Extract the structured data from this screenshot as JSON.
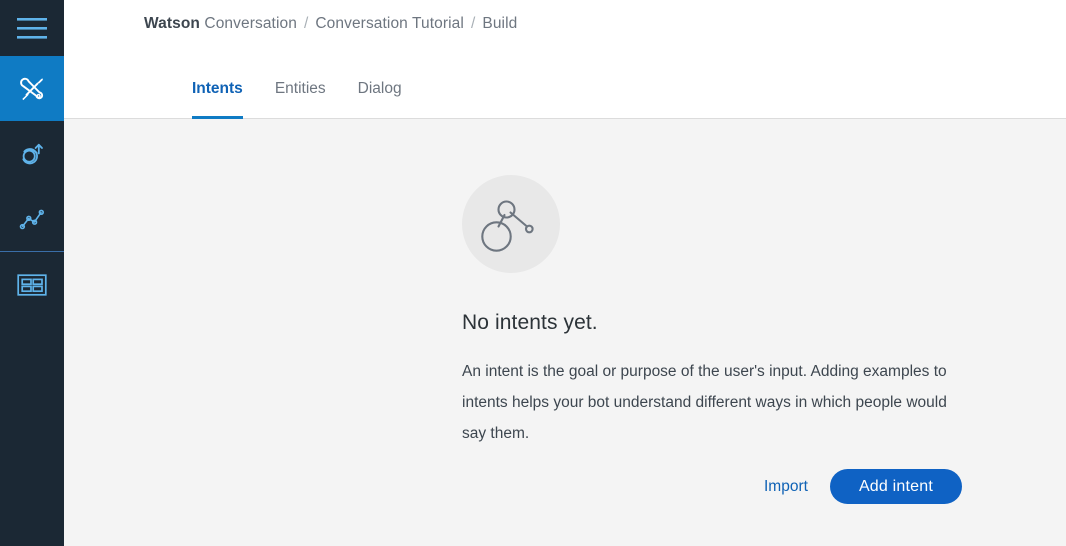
{
  "colors": {
    "rail_bg": "#1b2834",
    "rail_active": "#0f7bc4",
    "rail_icon": "#5fb3ea",
    "accent_blue": "#0f62c4",
    "tab_active": "#0f62b5",
    "content_bg": "#f4f4f4",
    "header_bg": "#ffffff",
    "empty_circle": "#e8e8e8",
    "empty_glyph": "#6e7680"
  },
  "rail": {
    "items": [
      {
        "name": "menu-icon",
        "label": "Menu",
        "active": false
      },
      {
        "name": "tools-icon",
        "label": "Build",
        "active": true
      },
      {
        "name": "improve-icon",
        "label": "Improve",
        "active": false
      },
      {
        "name": "analytics-icon",
        "label": "Analytics",
        "active": false
      },
      {
        "name": "deploy-icon",
        "label": "Deploy",
        "active": false
      }
    ]
  },
  "breadcrumb": {
    "product_strong": "Watson",
    "product_plain": "Conversation",
    "separator": "/",
    "workspace": "Conversation Tutorial",
    "section": "Build"
  },
  "tabs": [
    {
      "label": "Intents",
      "active": true
    },
    {
      "label": "Entities",
      "active": false
    },
    {
      "label": "Dialog",
      "active": false
    }
  ],
  "empty_state": {
    "icon_name": "intent-nodes-icon",
    "title": "No intents yet.",
    "body": "An intent is the goal or purpose of the user's input. Adding examples to intents helps your bot understand different ways in which people would say them."
  },
  "actions": {
    "import_label": "Import",
    "add_intent_label": "Add intent"
  }
}
